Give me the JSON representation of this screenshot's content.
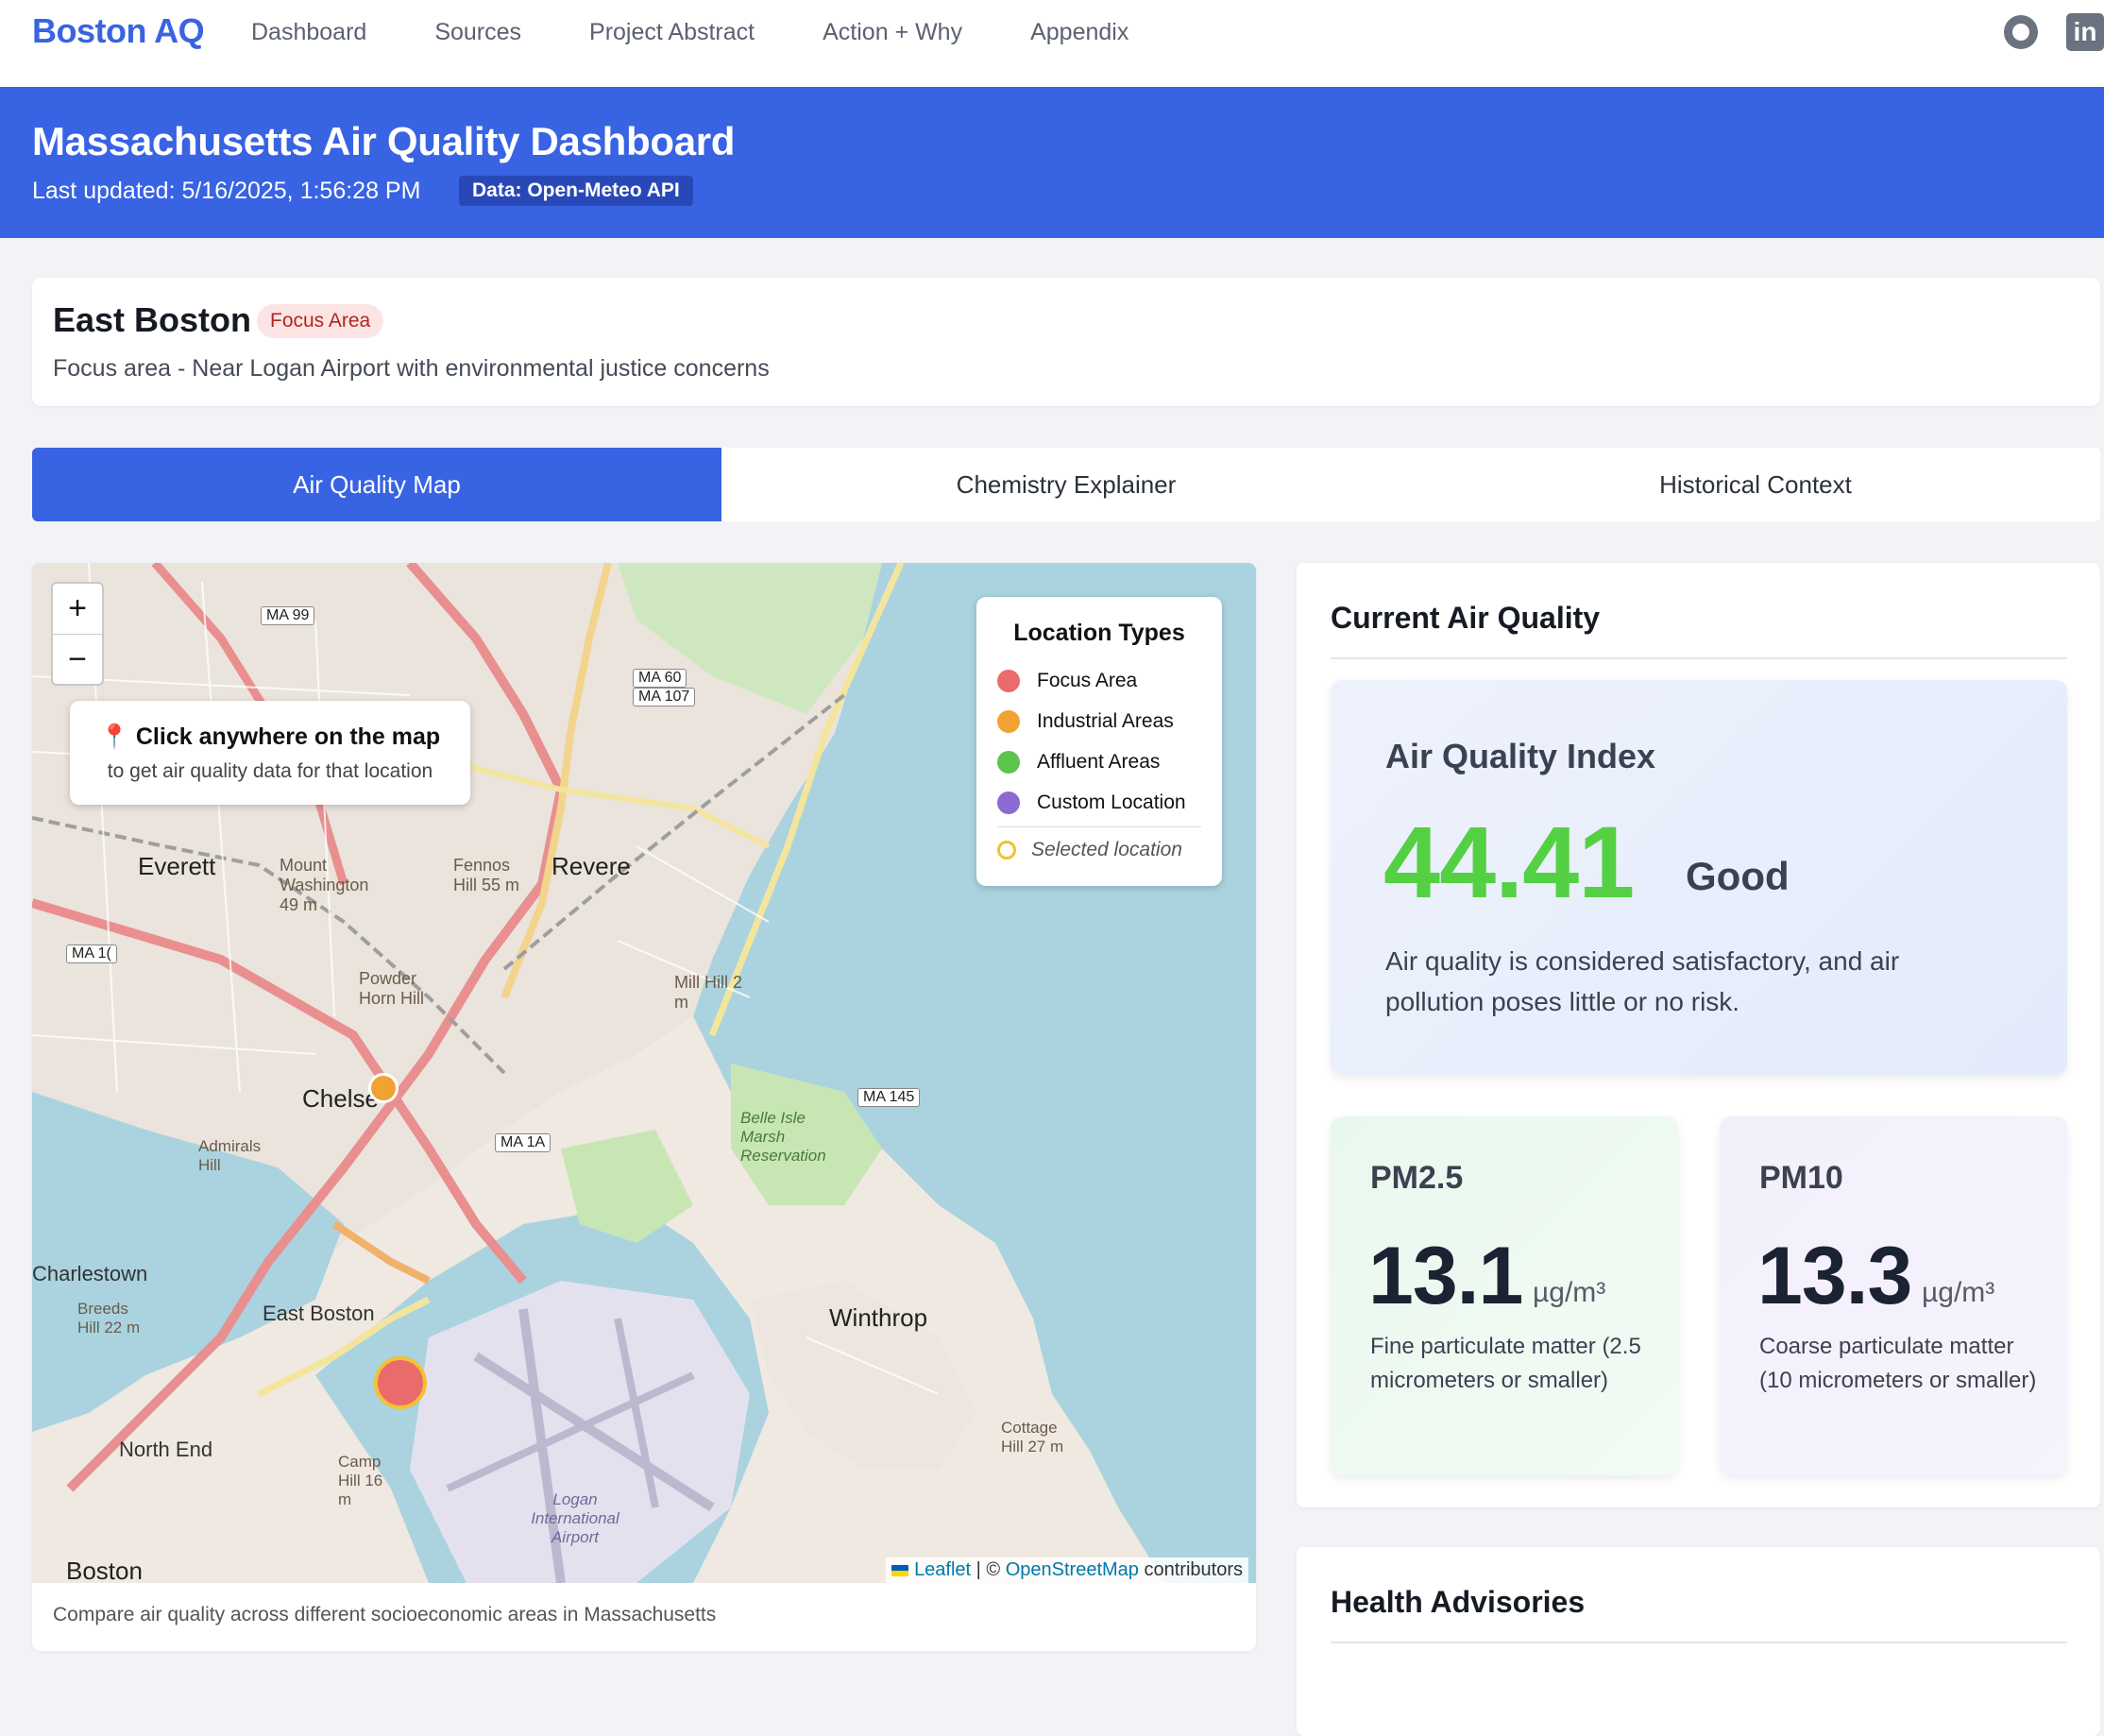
{
  "nav": {
    "brand": "Boston AQ",
    "links": [
      "Dashboard",
      "Sources",
      "Project Abstract",
      "Action + Why",
      "Appendix"
    ],
    "icons": [
      "github-icon",
      "linkedin-icon"
    ]
  },
  "header": {
    "title": "Massachusetts Air Quality Dashboard",
    "updated": "Last updated: 5/16/2025, 1:56:28 PM",
    "source_pill": "Data: Open-Meteo API"
  },
  "location": {
    "name": "East Boston",
    "badge": "Focus Area",
    "description": "Focus area - Near Logan Airport with environmental justice concerns"
  },
  "tabs": [
    {
      "label": "Air Quality Map",
      "active": true
    },
    {
      "label": "Chemistry Explainer",
      "active": false
    },
    {
      "label": "Historical Context",
      "active": false
    }
  ],
  "map": {
    "zoom_in": "+",
    "zoom_out": "−",
    "tip_title": "📍 Click anywhere on the map",
    "tip_sub": "to get air quality data for that location",
    "legend": {
      "title": "Location Types",
      "items": [
        {
          "label": "Focus Area",
          "color": "#ea6b6b"
        },
        {
          "label": "Industrial Areas",
          "color": "#f0a332"
        },
        {
          "label": "Affluent Areas",
          "color": "#5cc34f"
        },
        {
          "label": "Custom Location",
          "color": "#8b6ad1"
        }
      ],
      "selected_label": "Selected location"
    },
    "attribution": {
      "leaflet": "Leaflet",
      "sep": " | © ",
      "osm": "OpenStreetMap",
      "tail": " contributors"
    },
    "caption": "Compare air quality across different socioeconomic areas in Massachusetts",
    "place_labels": {
      "everett": "Everett",
      "revere": "Revere",
      "chelsea": "Chelse",
      "charlestown": "Charlestown",
      "east_boston": "East Boston",
      "winthrop": "Winthrop",
      "north_end": "North End",
      "boston": "Boston",
      "mount_washington": "Mount Washington 49 m",
      "fennos_hill": "Fennos Hill 55 m",
      "powder_horn": "Powder Horn Hill",
      "mill_hill": "Mill Hill 2 m",
      "belle_isle": "Belle Isle Marsh Reservation",
      "logan": "Logan International Airport",
      "camp_hill": "Camp Hill 16 m",
      "cottage_hill": "Cottage Hill 27 m",
      "admirals_hill": "Admirals Hill",
      "breeds_hill": "Breeds Hill 22 m"
    },
    "shields": {
      "ma99": "MA 99",
      "ma60": "MA 60",
      "ma107": "MA 107",
      "ma145": "MA 145",
      "ma1a": "MA 1A",
      "ma1": "MA 1("
    }
  },
  "air_quality": {
    "title": "Current Air Quality",
    "aqi_label": "Air Quality Index",
    "aqi_value": "44.41",
    "aqi_category": "Good",
    "aqi_message": "Air quality is considered satisfactory, and air pollution poses little or no risk.",
    "aqi_color": "#54d043",
    "pm25": {
      "label": "PM2.5",
      "value": "13.1",
      "unit": "µg/m³",
      "desc": "Fine particulate matter (2.5 micrometers or smaller)"
    },
    "pm10": {
      "label": "PM10",
      "value": "13.3",
      "unit": "µg/m³",
      "desc": "Coarse particulate matter (10 micrometers or smaller)"
    }
  },
  "health": {
    "title": "Health Advisories"
  }
}
